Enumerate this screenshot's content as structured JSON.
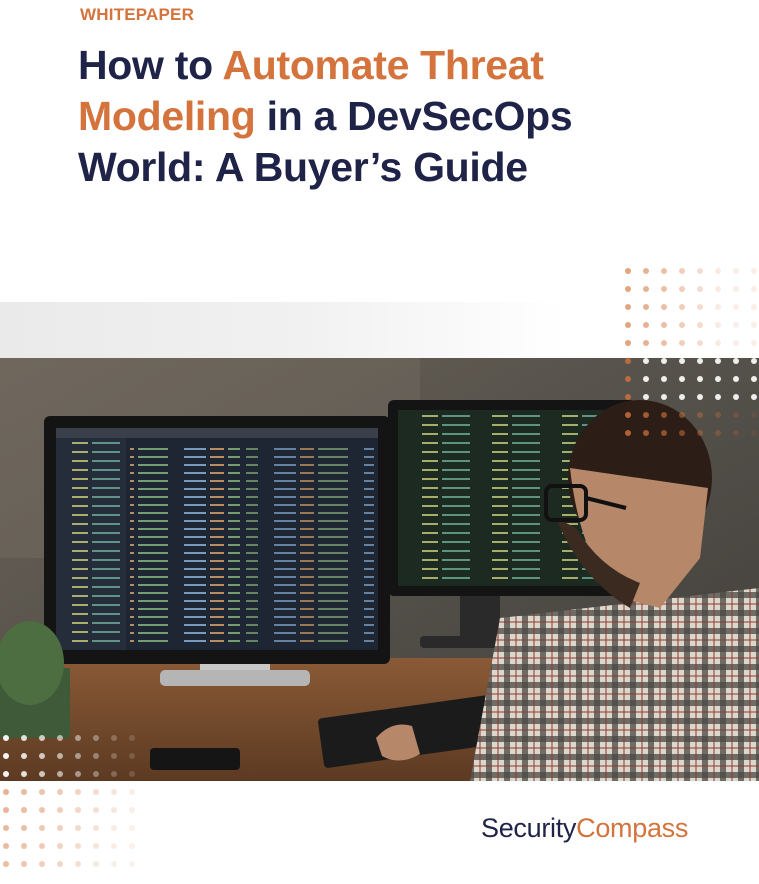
{
  "header": {
    "eyebrow": "WHITEPAPER",
    "title_parts": {
      "t1": "How to ",
      "t2": "Automate Threat",
      "t3": "Modeling",
      "t4": " in a DevSecOps",
      "t5": "World: A Buyer’s Guide"
    }
  },
  "colors": {
    "accent": "#d4733c",
    "navy": "#1e2347"
  },
  "logo": {
    "part1": "Security",
    "part2": "Compass"
  }
}
